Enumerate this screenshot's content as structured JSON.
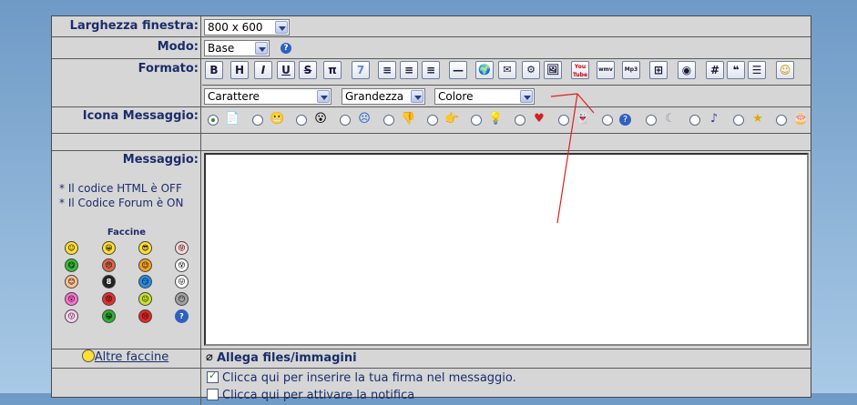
{
  "window_size": {
    "label": "Larghezza finestra:",
    "value": "800 x 600"
  },
  "mode": {
    "label": "Modo:",
    "value": "Base",
    "help": "?"
  },
  "format": {
    "label": "Formato:",
    "buttons": [
      "B",
      "H",
      "I",
      "U",
      "S",
      "π",
      "7",
      "≡",
      "≡",
      "≡",
      "—",
      "🌍",
      "✉",
      "⚙",
      "🖼",
      "You Tube",
      "wmv",
      "Mp3",
      "⊞",
      "◉",
      "#",
      "❝",
      "☰",
      "☺"
    ],
    "font_select": "Carattere",
    "size_select": "Grandezza",
    "color_select": "Colore"
  },
  "message_icon": {
    "label": "Icona Messaggio:",
    "icons": [
      "📄",
      "😬",
      "😮",
      "☹",
      "👎",
      "👉",
      "💡",
      "♥",
      "👻",
      "?",
      "☾",
      "♪",
      "★",
      "🎂"
    ]
  },
  "message": {
    "label": "Messaggio:",
    "html_note": "* Il codice HTML è OFF",
    "forum_note": "* Il Codice Forum è ON",
    "smileys_title": "Faccine",
    "smileys": [
      "☺",
      "😀",
      "😎",
      "😝",
      "😋",
      "😠",
      "😉",
      "😵",
      "😊",
      "8",
      "😏",
      "😛",
      "😲",
      "😡",
      "😐",
      "😶",
      "😗",
      "😁",
      "😢",
      "?"
    ]
  },
  "more_smileys": "Altre faccine",
  "attach": {
    "label": "Allega files/immagini"
  },
  "options": {
    "signature": "Clicca qui per inserire la tua firma nel messaggio.",
    "second": "Clicca qui per attivare la notifica"
  },
  "colors": {
    "label": "#1a2d6b",
    "accent_red": "#e0201c"
  }
}
